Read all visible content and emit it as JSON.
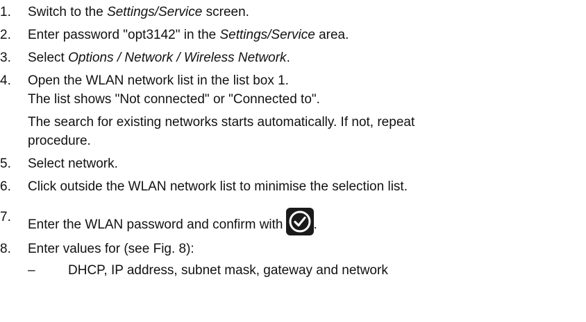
{
  "steps": [
    {
      "num": "1.",
      "pre": "Switch to the ",
      "em": "Settings/Service",
      "post": " screen."
    },
    {
      "num": "2.",
      "pre": "Enter password \"opt3142\" in the ",
      "em": "Settings/Service",
      "post": " area."
    },
    {
      "num": "3.",
      "pre": "Select ",
      "em": "Options / Network / Wireless Network",
      "post": "."
    },
    {
      "num": "4.",
      "text": "Open the WLAN network list in the list box 1.",
      "continuation": [
        "The list shows \"Not connected\" or \"Connected to\".",
        "The search for existing networks starts automatically. If not, repeat",
        "procedure."
      ]
    },
    {
      "num": "5.",
      "text": "Select network."
    },
    {
      "num": "6.",
      "text": "Click outside the WLAN network list to minimise the selection list."
    },
    {
      "num": "7.",
      "text": "Enter the WLAN  password and confirm with",
      "post": "."
    },
    {
      "num": "8.",
      "text": "Enter values for (see Fig. 8):",
      "sub": [
        {
          "dash": "–",
          "text": "DHCP, IP address, subnet mask, gateway and network"
        }
      ]
    }
  ],
  "icons": {
    "confirm": "checkmark-circle-icon"
  },
  "colors": {
    "text": "#111111",
    "icon_bg": "#1a1a1a",
    "icon_ring": "#ffffff"
  }
}
